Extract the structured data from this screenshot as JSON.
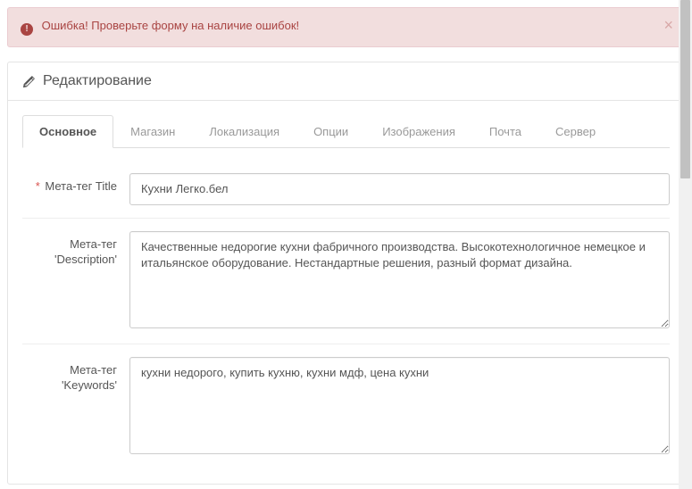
{
  "alert": {
    "text": "Ошибка! Проверьте форму на наличие ошибок!"
  },
  "panel": {
    "title": "Редактирование"
  },
  "tabs": [
    {
      "label": "Основное",
      "active": true
    },
    {
      "label": "Магазин",
      "active": false
    },
    {
      "label": "Локализация",
      "active": false
    },
    {
      "label": "Опции",
      "active": false
    },
    {
      "label": "Изображения",
      "active": false
    },
    {
      "label": "Почта",
      "active": false
    },
    {
      "label": "Сервер",
      "active": false
    }
  ],
  "form": {
    "meta_title": {
      "label": "Мета-тег Title",
      "value": "Кухни Легко.бел",
      "required": true
    },
    "meta_description": {
      "label": "Мета-тег 'Description'",
      "value": "Качественные недорогие кухни фабричного производства. Высокотехнологичное немецкое и итальянское оборудование. Нестандартные решения, разный формат дизайна.",
      "required": false
    },
    "meta_keywords": {
      "label": "Мета-тег 'Keywords'",
      "value": "кухни недорого, купить кухню, кухни мдф, цена кухни",
      "required": false
    }
  }
}
